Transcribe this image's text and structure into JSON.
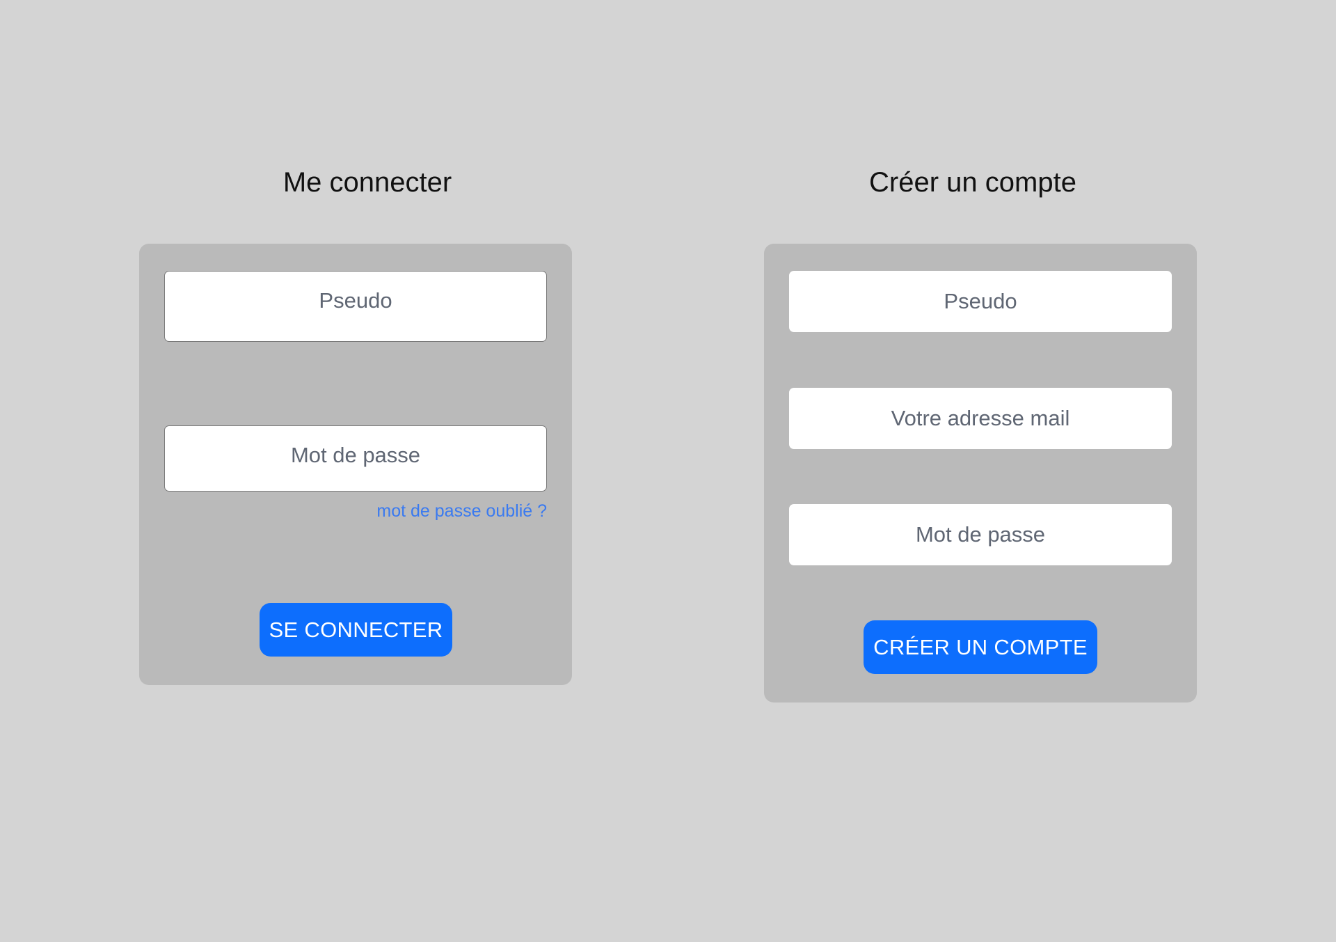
{
  "login": {
    "title": "Me connecter",
    "username_placeholder": "Pseudo",
    "password_placeholder": "Mot de passe",
    "forgot_password_link": "mot de passe oublié ?",
    "submit_label": "SE CONNECTER"
  },
  "register": {
    "title": "Créer un compte",
    "username_placeholder": "Pseudo",
    "email_placeholder": "Votre adresse mail",
    "password_placeholder": "Mot de passe",
    "submit_label": "CRÉER UN COMPTE"
  },
  "colors": {
    "page_background": "#d4d4d4",
    "panel_background": "#bababa",
    "button_primary": "#0d6efd",
    "link": "#3a7af0",
    "placeholder_text": "#5f6673"
  }
}
